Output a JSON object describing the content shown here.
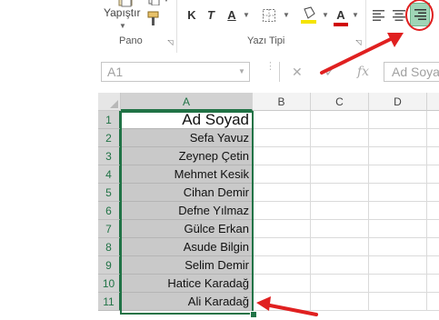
{
  "ribbon": {
    "paste_label": "Yapıştır",
    "bold": "K",
    "italic": "T",
    "underline": "A",
    "font_color_letter": "A",
    "groups": {
      "clipboard": "Pano",
      "font": "Yazı Tipi"
    }
  },
  "formula_bar": {
    "name_box": "A1",
    "fx": "fx",
    "value": "Ad Soyad"
  },
  "sheet": {
    "columns": [
      "A",
      "B",
      "C",
      "D"
    ],
    "rows": [
      "1",
      "2",
      "3",
      "4",
      "5",
      "6",
      "7",
      "8",
      "9",
      "10",
      "11"
    ],
    "cells": [
      "Ad Soyad",
      "Sefa Yavuz",
      "Zeynep Çetin",
      "Mehmet Kesik",
      "Cihan Demir",
      "Defne Yılmaz",
      "Gülce Erkan",
      "Asude Bilgin",
      "Selim Demir",
      "Hatice Karadağ",
      "Ali Karadağ"
    ]
  },
  "colors": {
    "accent": "#217346",
    "arrow": "#e02020",
    "highlight_button": "#9fd5b6"
  },
  "icons": [
    "paste-icon",
    "format-painter-icon",
    "borders-icon",
    "fill-color-icon",
    "font-color-icon",
    "align-left-icon",
    "align-center-icon",
    "align-right-icon",
    "dialog-launcher-icon",
    "cancel-icon",
    "enter-icon"
  ]
}
